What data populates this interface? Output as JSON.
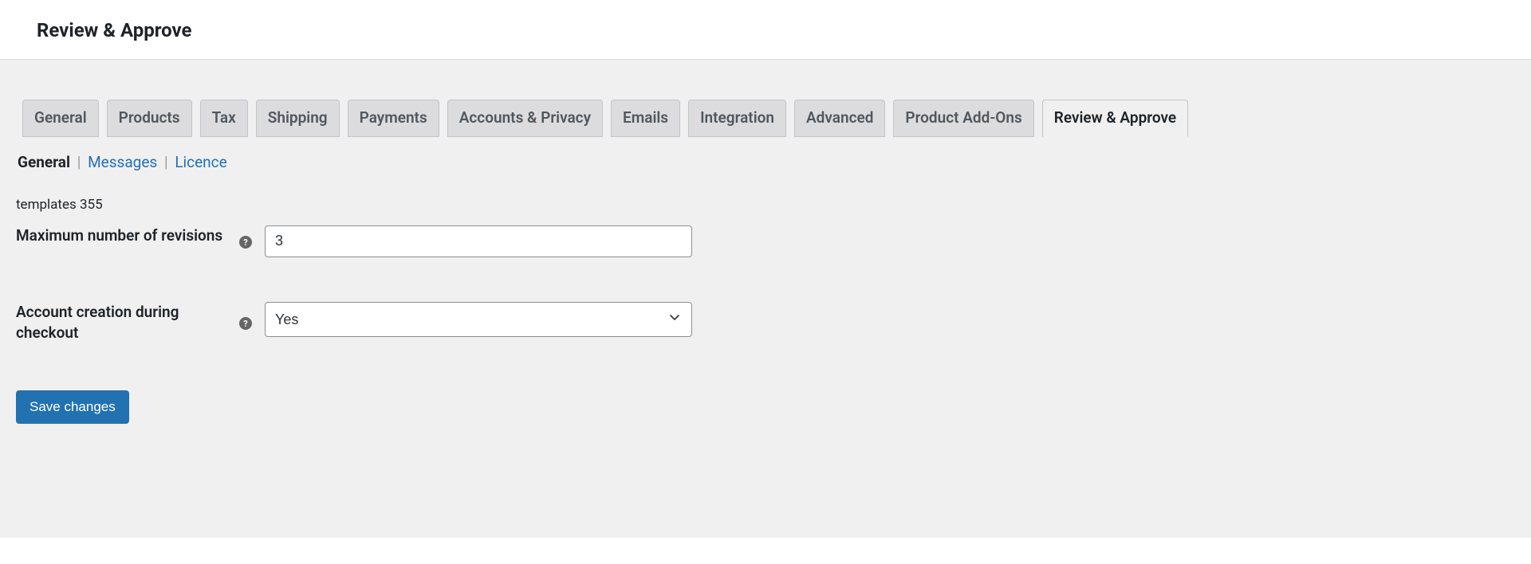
{
  "header": {
    "title": "Review & Approve"
  },
  "tabs": [
    {
      "label": "General",
      "active": false
    },
    {
      "label": "Products",
      "active": false
    },
    {
      "label": "Tax",
      "active": false
    },
    {
      "label": "Shipping",
      "active": false
    },
    {
      "label": "Payments",
      "active": false
    },
    {
      "label": "Accounts & Privacy",
      "active": false
    },
    {
      "label": "Emails",
      "active": false
    },
    {
      "label": "Integration",
      "active": false
    },
    {
      "label": "Advanced",
      "active": false
    },
    {
      "label": "Product Add-Ons",
      "active": false
    },
    {
      "label": "Review & Approve",
      "active": true
    }
  ],
  "subtabs": {
    "general": "General",
    "messages": "Messages",
    "licence": "Licence",
    "sep": "|"
  },
  "fields": {
    "max_revisions": {
      "label": "Maximum number of revisions",
      "value": "3"
    },
    "account_creation": {
      "label": "Account creation during checkout",
      "value": "Yes"
    }
  },
  "buttons": {
    "save": "Save changes"
  }
}
